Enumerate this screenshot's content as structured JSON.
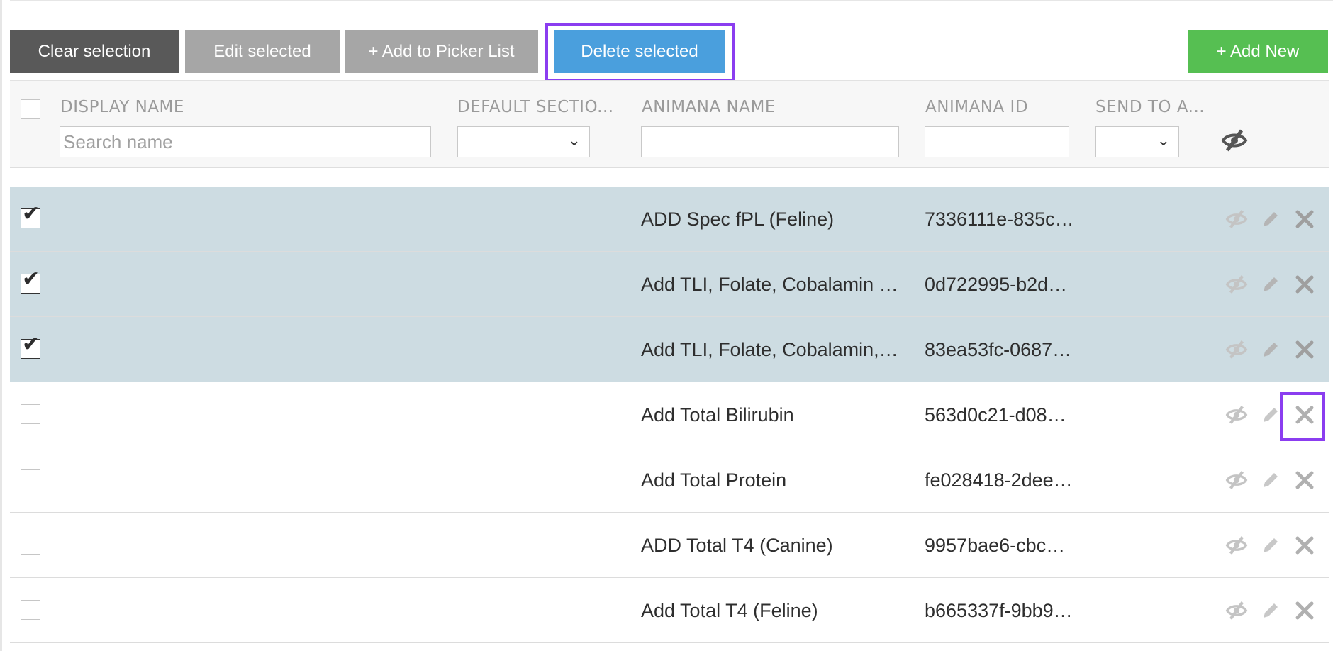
{
  "toolbar": {
    "clear_label": "Clear selection",
    "edit_label": "Edit selected",
    "picker_label": "+ Add to Picker List",
    "delete_label": "Delete selected",
    "add_new_label": "+ Add New"
  },
  "columns": {
    "display_name": "DISPLAY NAME",
    "default_section": "DEFAULT SECTIO...",
    "animana_name": "ANIMANA NAME",
    "animana_id": "ANIMANA ID",
    "send_to": "SEND TO A..."
  },
  "filters": {
    "search_placeholder": "Search name",
    "animana_name_value": "",
    "animana_id_value": ""
  },
  "rows": [
    {
      "selected": true,
      "display_name": "",
      "animana_name": "ADD Spec fPL (Feline)",
      "animana_id": "7336111e-835c…"
    },
    {
      "selected": true,
      "display_name": "",
      "animana_name": "Add TLI, Folate, Cobalamin …",
      "animana_id": "0d722995-b2d…"
    },
    {
      "selected": true,
      "display_name": "",
      "animana_name": "Add TLI, Folate, Cobalamin,…",
      "animana_id": "83ea53fc-0687…"
    },
    {
      "selected": false,
      "display_name": "",
      "animana_name": "Add Total Bilirubin",
      "animana_id": "563d0c21-d08…"
    },
    {
      "selected": false,
      "display_name": "",
      "animana_name": "Add Total Protein",
      "animana_id": "fe028418-2dee…"
    },
    {
      "selected": false,
      "display_name": "",
      "animana_name": "ADD Total T4 (Canine)",
      "animana_id": "9957bae6-cbc…"
    },
    {
      "selected": false,
      "display_name": "",
      "animana_name": "Add Total T4 (Feline)",
      "animana_id": "b665337f-9bb9…"
    }
  ],
  "colors": {
    "selected_row": "#cddce2",
    "delete_button": "#4a9fdd",
    "add_new_button": "#56bf52",
    "highlight": "#8b3df0"
  }
}
